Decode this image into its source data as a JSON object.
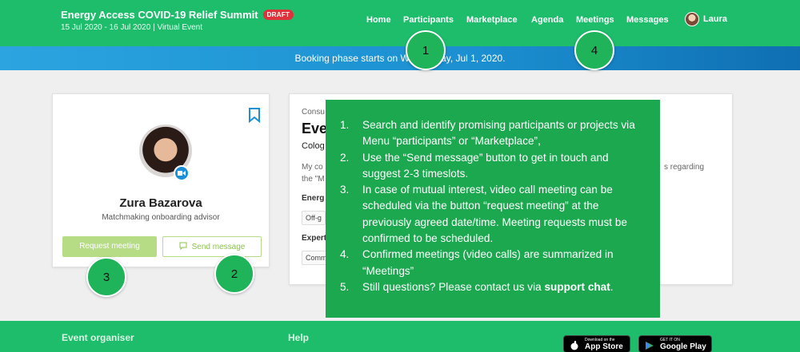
{
  "header": {
    "event_title": "Energy Access COVID-19 Relief Summit",
    "draft_badge": "DRAFT",
    "event_meta": "15 Jul 2020 - 16 Jul 2020 | Virtual Event",
    "nav": [
      "Home",
      "Participants",
      "Marketplace",
      "Agenda",
      "Meetings",
      "Messages"
    ],
    "user_name": "Laura"
  },
  "banner": {
    "text": "Booking phase starts on Wednesday, Jul 1, 2020."
  },
  "callouts": [
    "1",
    "4",
    "3",
    "2"
  ],
  "profile": {
    "name": "Zura Bazarova",
    "role": "Matchmaking onboarding advisor",
    "request_label": "Request meeting",
    "send_label": "Send message"
  },
  "detail": {
    "kicker": "Consu",
    "title": "Eve",
    "subtitle": "Colog",
    "desc_left": "My co",
    "desc_left2": "the \"M",
    "desc_right": "s regarding",
    "energy_label": "Energ",
    "energy_chip": "Off-g",
    "expertise_label": "Expert",
    "expertise_chip": "Comm"
  },
  "instructions": {
    "items": [
      {
        "n": "1.",
        "text": "Search and identify promising participants or projects via Menu “participants” or “Marketplace”,"
      },
      {
        "n": "2.",
        "text": "Use the “Send message” button to get in touch and suggest 2-3 timeslots."
      },
      {
        "n": "3.",
        "text": "In case of mutual interest, video call meeting can be scheduled via the button “request meeting” at the previously agreed date/time. Meeting requests must be confirmed to be scheduled."
      },
      {
        "n": "4.",
        "text": "Confirmed meetings (video calls) are summarized in “Meetings”"
      },
      {
        "n": "5.",
        "text": "Still questions? Please contact us via ",
        "bold": "support chat",
        "tail": "."
      }
    ]
  },
  "footer": {
    "organiser": "Event organiser",
    "help": "Help",
    "app_store_small": "Download on the",
    "app_store": "App Store",
    "google_small": "GET IT ON",
    "google": "Google Play"
  },
  "colors": {
    "brand_green": "#1dbd6b",
    "overlay_green": "#1ba84f",
    "draft_red": "#e0323a",
    "banner_blue": "#1b8fd0"
  }
}
